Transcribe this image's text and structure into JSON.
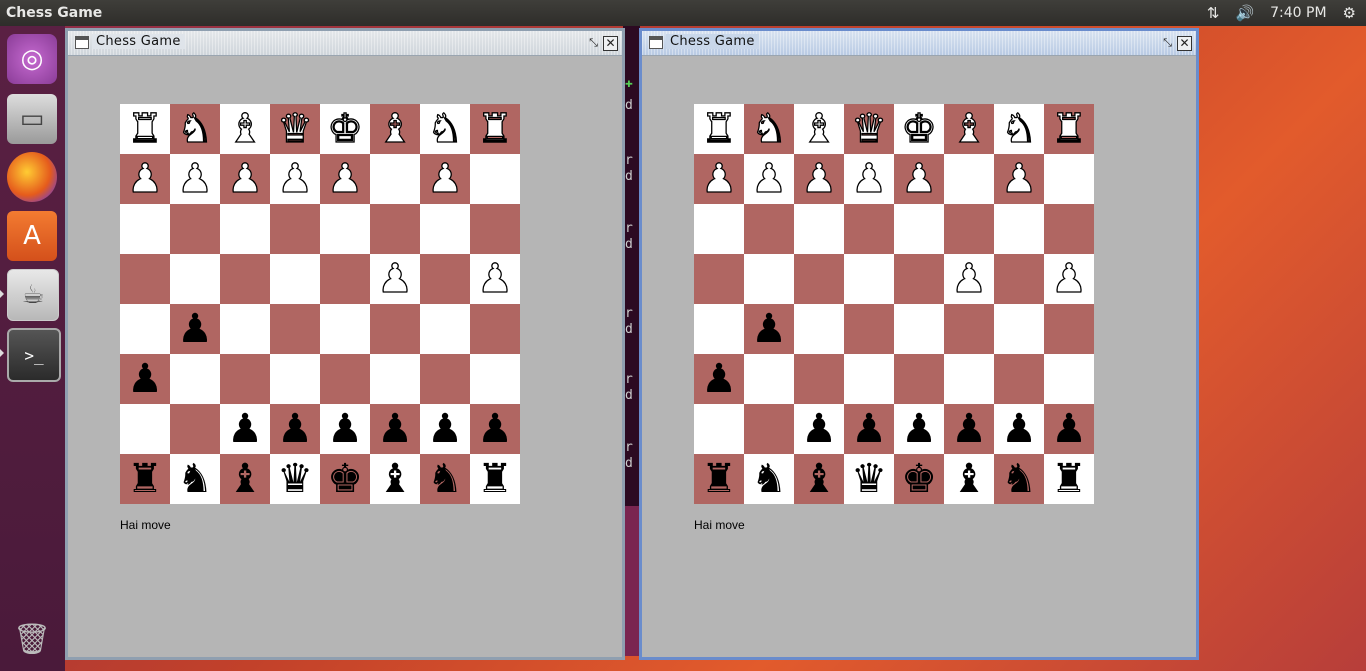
{
  "top_panel": {
    "title": "Chess Game",
    "time": "7:40 PM",
    "icons": [
      "network-updown-icon",
      "volume-icon",
      "settings-gear-icon"
    ]
  },
  "launcher": {
    "items": [
      "ubuntu-logo-icon",
      "files-icon",
      "firefox-icon",
      "software-center-icon",
      "java-app-icon",
      "terminal-icon"
    ],
    "bottom_item": "trash-icon"
  },
  "colors": {
    "light_square": "#ffffff",
    "dark_square": "#b06662",
    "window_bg": "#b5b5b5"
  },
  "windows": [
    {
      "title": "Chess Game",
      "status": "Hai move",
      "board": [
        [
          "wR",
          "wN",
          "wB",
          "wQ",
          "wK",
          "wB",
          "wN",
          "wR"
        ],
        [
          "wP",
          "wP",
          "wP",
          "wP",
          "wP",
          "",
          "wP",
          ""
        ],
        [
          "",
          "",
          "",
          "",
          "",
          "",
          "",
          ""
        ],
        [
          "",
          "",
          "",
          "",
          "",
          "wP",
          "",
          "wP"
        ],
        [
          "",
          "bP",
          "",
          "",
          "",
          "",
          "",
          ""
        ],
        [
          "bP",
          "",
          "",
          "",
          "",
          "",
          "",
          ""
        ],
        [
          "",
          "",
          "bP",
          "bP",
          "bP",
          "bP",
          "bP",
          "bP"
        ],
        [
          "bR",
          "bN",
          "bB",
          "bQ",
          "bK",
          "bB",
          "bN",
          "bR"
        ]
      ]
    },
    {
      "title": "Chess Game",
      "status": "Hai move",
      "board": [
        [
          "wR",
          "wN",
          "wB",
          "wQ",
          "wK",
          "wB",
          "wN",
          "wR"
        ],
        [
          "wP",
          "wP",
          "wP",
          "wP",
          "wP",
          "",
          "wP",
          ""
        ],
        [
          "",
          "",
          "",
          "",
          "",
          "",
          "",
          ""
        ],
        [
          "",
          "",
          "",
          "",
          "",
          "wP",
          "",
          "wP"
        ],
        [
          "",
          "bP",
          "",
          "",
          "",
          "",
          "",
          ""
        ],
        [
          "bP",
          "",
          "",
          "",
          "",
          "",
          "",
          ""
        ],
        [
          "",
          "",
          "bP",
          "bP",
          "bP",
          "bP",
          "bP",
          "bP"
        ],
        [
          "bR",
          "bN",
          "bB",
          "bQ",
          "bK",
          "bB",
          "bN",
          "bR"
        ]
      ]
    }
  ]
}
